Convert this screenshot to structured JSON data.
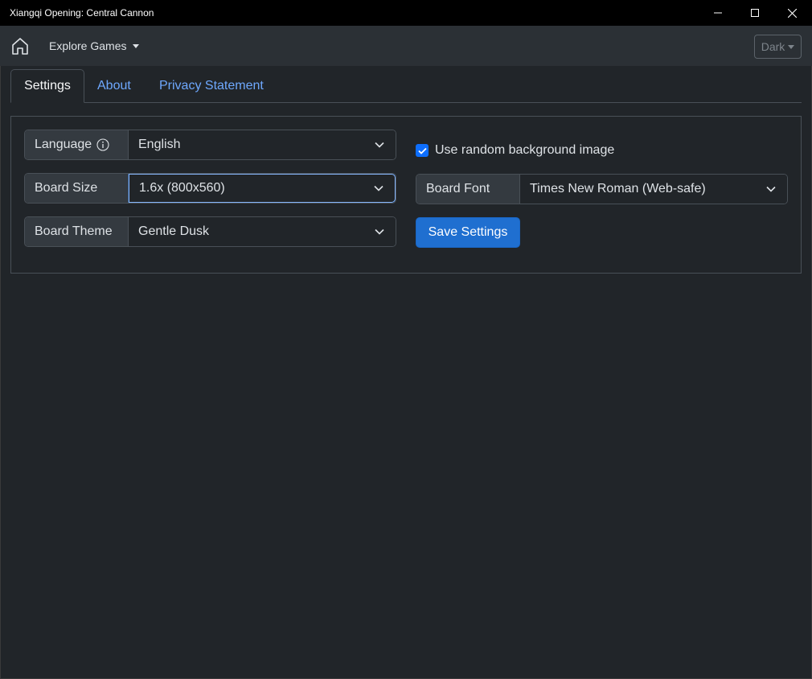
{
  "window": {
    "title": "Xiangqi Opening: Central Cannon",
    "controls": [
      "minimize-icon",
      "maximize-icon",
      "close-icon"
    ]
  },
  "navbar": {
    "home_icon": "home-icon",
    "explore_label": "Explore Games",
    "theme_label": "Dark"
  },
  "tabs": [
    {
      "label": "Settings",
      "active": true
    },
    {
      "label": "About",
      "active": false
    },
    {
      "label": "Privacy Statement",
      "active": false
    }
  ],
  "settings": {
    "language": {
      "label": "Language",
      "value": "English",
      "info_icon": "info-icon"
    },
    "board_size": {
      "label": "Board Size",
      "value": "1.6x (800x560)",
      "focused": true
    },
    "board_theme": {
      "label": "Board Theme",
      "value": "Gentle Dusk"
    },
    "random_background": {
      "label": "Use random background image",
      "checked": true
    },
    "board_font": {
      "label": "Board Font",
      "value": "Times New Roman (Web-safe)"
    },
    "save_label": "Save Settings"
  },
  "colors": {
    "background": "#212529",
    "navbar": "#2b3035",
    "link": "#6ea8fe",
    "primary": "#1f6fd0",
    "titlebar": "#000000"
  }
}
